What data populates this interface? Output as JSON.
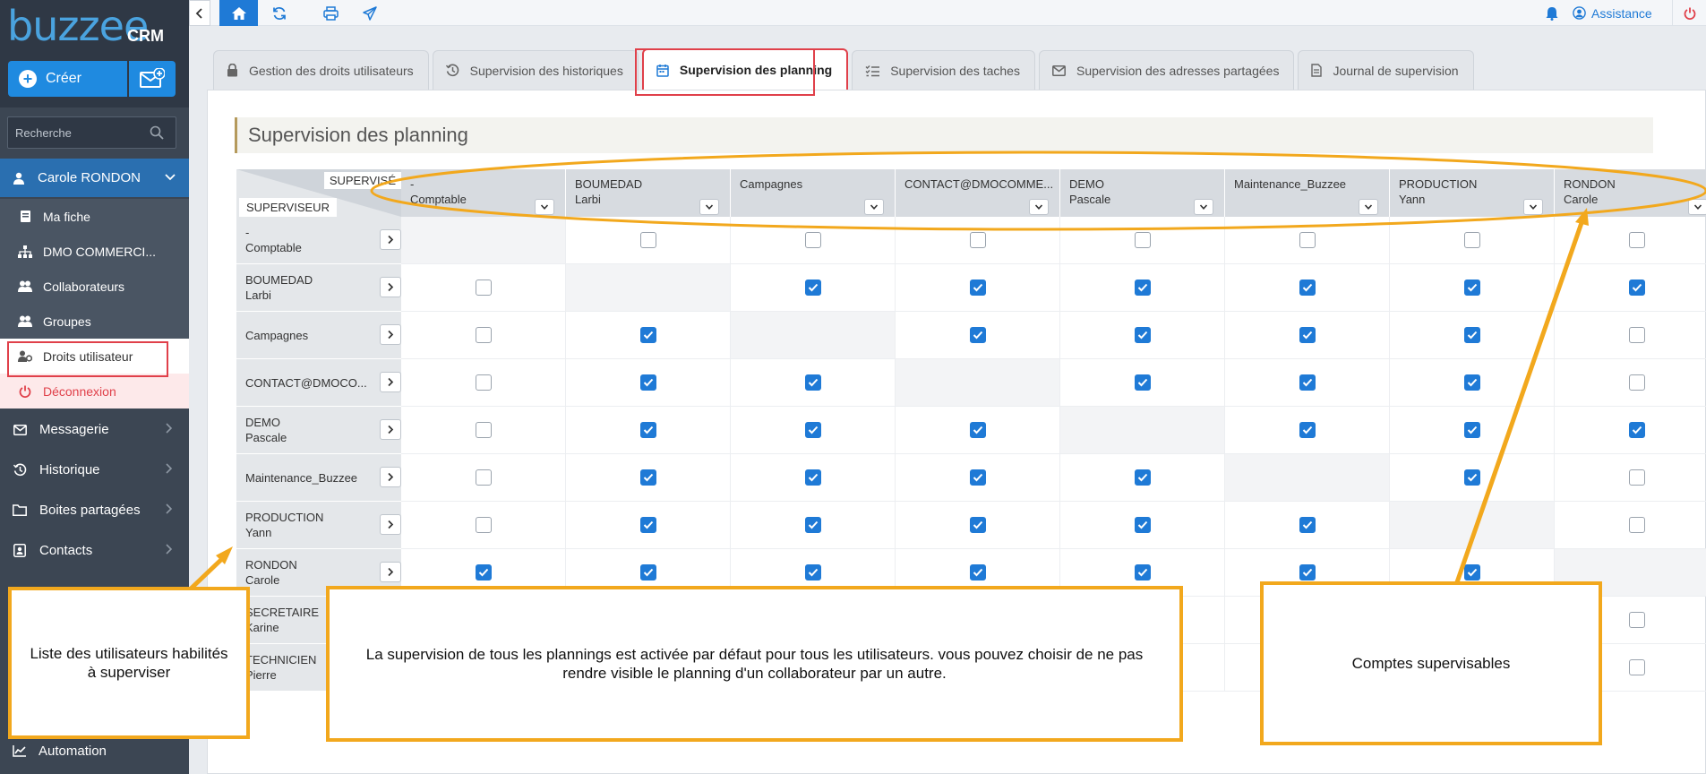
{
  "brand": {
    "logo": "buzzee",
    "logo_sub": "CRM"
  },
  "sidebar": {
    "create_label": "Créer",
    "search_placeholder": "Recherche",
    "user_name": "Carole RONDON",
    "submenu": [
      {
        "label": "Ma fiche",
        "icon": "id-card-icon"
      },
      {
        "label": "DMO COMMERCI...",
        "icon": "org-chart-icon"
      },
      {
        "label": "Collaborateurs",
        "icon": "users-icon"
      },
      {
        "label": "Groupes",
        "icon": "users-icon"
      },
      {
        "label": "Droits utilisateur",
        "icon": "user-gear-icon",
        "active": true
      },
      {
        "label": "Déconnexion",
        "icon": "power-icon"
      }
    ],
    "menu": [
      {
        "label": "Messagerie",
        "icon": "envelope-icon"
      },
      {
        "label": "Historique",
        "icon": "history-icon"
      },
      {
        "label": "Boites partagées",
        "icon": "folder-icon"
      },
      {
        "label": "Contacts",
        "icon": "address-book-icon"
      }
    ],
    "automation_label": "Automation"
  },
  "topbar": {
    "assist_label": "Assistance"
  },
  "tabs": [
    {
      "label": "Gestion des droits utilisateurs",
      "icon": "lock-icon"
    },
    {
      "label": "Supervision des historiques",
      "icon": "history-icon"
    },
    {
      "label": "Supervision des planning",
      "icon": "calendar-icon",
      "active": true
    },
    {
      "label": "Supervision des taches",
      "icon": "tasks-icon"
    },
    {
      "label": "Supervision des adresses partagées",
      "icon": "envelope-icon"
    },
    {
      "label": "Journal de supervision",
      "icon": "file-icon"
    }
  ],
  "page_title": "Supervision des planning",
  "matrix": {
    "corner_supervised": "SUPERVISÉ",
    "corner_supervisor": "SUPERVISEUR",
    "columns": [
      [
        "-",
        "Comptable"
      ],
      [
        "BOUMEDAD",
        "Larbi"
      ],
      [
        "Campagnes",
        ""
      ],
      [
        "CONTACT@DMOCOMME...",
        ""
      ],
      [
        "DEMO",
        "Pascale"
      ],
      [
        "Maintenance_Buzzee",
        ""
      ],
      [
        "PRODUCTION",
        "Yann"
      ],
      [
        "RONDON",
        "Carole"
      ]
    ],
    "rows": [
      {
        "label": [
          "-",
          "Comptable"
        ],
        "checks": [
          null,
          false,
          false,
          false,
          false,
          false,
          false,
          false
        ]
      },
      {
        "label": [
          "BOUMEDAD",
          "Larbi"
        ],
        "checks": [
          false,
          null,
          true,
          true,
          true,
          true,
          true,
          true
        ]
      },
      {
        "label": [
          "Campagnes",
          ""
        ],
        "checks": [
          false,
          true,
          null,
          true,
          true,
          true,
          true,
          false
        ]
      },
      {
        "label": [
          "CONTACT@DMOCO...",
          ""
        ],
        "checks": [
          false,
          true,
          true,
          null,
          true,
          true,
          true,
          false
        ]
      },
      {
        "label": [
          "DEMO",
          "Pascale"
        ],
        "checks": [
          false,
          true,
          true,
          true,
          null,
          true,
          true,
          true
        ]
      },
      {
        "label": [
          "Maintenance_Buzzee",
          ""
        ],
        "checks": [
          false,
          true,
          true,
          true,
          true,
          null,
          true,
          false
        ]
      },
      {
        "label": [
          "PRODUCTION",
          "Yann"
        ],
        "checks": [
          false,
          true,
          true,
          true,
          true,
          true,
          null,
          false
        ]
      },
      {
        "label": [
          "RONDON",
          "Carole"
        ],
        "checks": [
          true,
          true,
          true,
          true,
          true,
          true,
          true,
          null
        ]
      },
      {
        "label": [
          "SECRETAIRE",
          "Karine"
        ],
        "checks": [
          null,
          null,
          null,
          null,
          null,
          null,
          null,
          false
        ]
      },
      {
        "label": [
          "TECHNICIEN",
          "Pierre"
        ],
        "checks": [
          null,
          null,
          null,
          null,
          null,
          null,
          null,
          false
        ]
      }
    ]
  },
  "annotations": {
    "left_note": "Liste des utilisateurs habilités à superviser",
    "center_note": "La supervision de tous les plannings est activée par défaut pour tous les utilisateurs. vous pouvez choisir de ne pas rendre visible le planning d'un collaborateur par un autre.",
    "right_note": "Comptes supervisables",
    "accent_color": "#f2a81d",
    "highlight_color": "#e0404a"
  }
}
